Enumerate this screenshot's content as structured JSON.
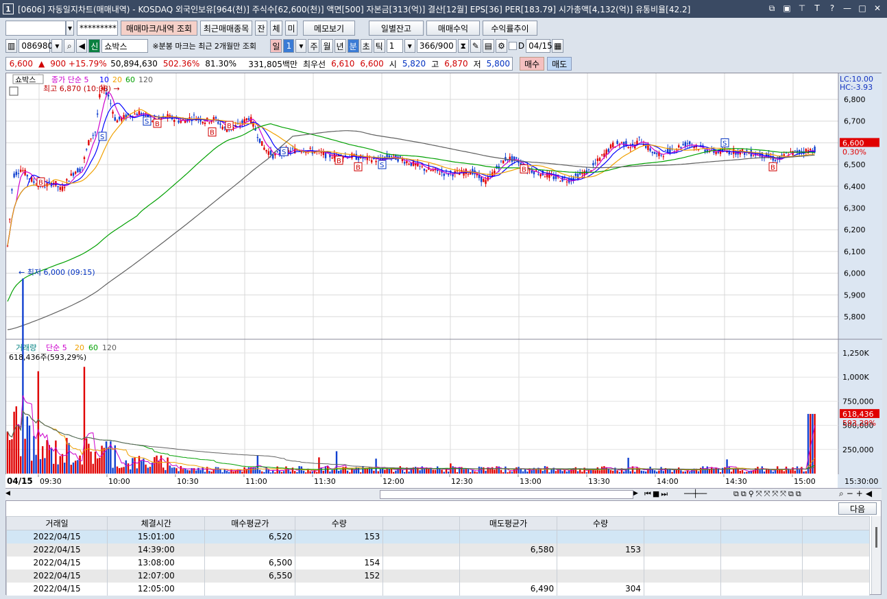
{
  "window": {
    "number": "1",
    "title": "[0606] 자동일지차트(매매내역) - KOSDAQ 외국인보유[964(천)] 주식수[62,600(천)] 액면[500] 자본금[313(억)] 결산[12월] EPS[36] PER[183.79] 시가총액[4,132(억)] 유통비율[42.2]",
    "ctrl_icons": [
      "restore-down-icon",
      "tile-icon",
      "pin-icon",
      "font-icon",
      "help-icon",
      "minimize-icon",
      "maximize-icon",
      "close-icon"
    ],
    "ctrl_glyphs": [
      "⧉",
      "▣",
      "⊤",
      "T",
      "?",
      "—",
      "□",
      "✕"
    ]
  },
  "toolbar1": {
    "account_value": "",
    "password_value": "*********",
    "buttons": [
      "매매마크/내역 조회",
      "최근매매종목",
      "잔",
      "체",
      "미",
      "메모보기",
      "일별잔고",
      "매매수익",
      "수익률추이"
    ]
  },
  "toolbar2": {
    "code": "086980",
    "stock_name": "쇼박스",
    "note": "※분봉 마크는 최근 2개월만 조회",
    "periods": [
      "일",
      "1",
      "주",
      "월",
      "년",
      "분",
      "초",
      "틱"
    ],
    "interval": "1",
    "count": "366/900",
    "d_label": "D",
    "date": "04/15"
  },
  "quote": {
    "price": "6,600",
    "arrow": "▲",
    "change": "900 +15.79%",
    "volume": "50,894,630",
    "vol_ratio": "502.36%",
    "rate": "81.30%",
    "amount": "331,805백만",
    "best_label": "최우선",
    "ask": "6,610",
    "bid": "6,600",
    "open_label": "시",
    "open": "5,820",
    "high_label": "고",
    "high": "6,870",
    "low_label": "저",
    "low": "5,800",
    "buy_btn": "매수",
    "sell_btn": "매도"
  },
  "price_panel": {
    "title": "쇼박스",
    "ma_label": "종가 단순 5",
    "ma": [
      "10",
      "20",
      "60",
      "120"
    ],
    "high_note": "최고 6,870 (10:08)",
    "low_note": "최저 6,000 (09:15)",
    "lc": "LC:10.00",
    "hc": "HC:-3.93",
    "y_ticks": [
      "6,800",
      "6,700",
      "6,600",
      "6,500",
      "6,400",
      "6,300",
      "6,200",
      "6,100",
      "6,000",
      "5,900",
      "5,800"
    ],
    "current": "6,600",
    "current_pct": "0.30%"
  },
  "volume_panel": {
    "title": "거래량",
    "ma_label": "단순 5",
    "ma": [
      "20",
      "60",
      "120"
    ],
    "note": "618,436주(593,29%)",
    "y_ticks": [
      "1,250K",
      "1,000K",
      "750,000",
      "500,000",
      "250,000"
    ],
    "current": "618,436",
    "current_pct": "593,29%"
  },
  "x_axis": {
    "date": "04/15",
    "ticks": [
      "09:30",
      "10:00",
      "10:30",
      "11:00",
      "11:30",
      "12:00",
      "12:30",
      "13:00",
      "13:30",
      "14:00",
      "14:30",
      "15:00"
    ],
    "end": "15:30:00"
  },
  "table": {
    "next_btn": "다음",
    "headers": [
      "거래일",
      "체결시간",
      "매수평균가",
      "수량",
      "",
      "매도평균가",
      "수량",
      "",
      "",
      ""
    ],
    "rows": [
      [
        "2022/04/15",
        "15:01:00",
        "6,520",
        "153",
        "",
        "",
        "",
        "",
        "",
        ""
      ],
      [
        "2022/04/15",
        "14:39:00",
        "",
        "",
        "",
        "6,580",
        "153",
        "",
        "",
        ""
      ],
      [
        "2022/04/15",
        "13:08:00",
        "6,500",
        "154",
        "",
        "",
        "",
        "",
        "",
        ""
      ],
      [
        "2022/04/15",
        "12:07:00",
        "6,550",
        "152",
        "",
        "",
        "",
        "",
        "",
        ""
      ],
      [
        "2022/04/15",
        "12:05:00",
        "",
        "",
        "",
        "6,490",
        "304",
        "",
        "",
        ""
      ]
    ]
  },
  "colors": {
    "up": "#e00000",
    "down": "#1040d0",
    "ma5": "#cc00cc",
    "ma10": "#0000ff",
    "ma20": "#f0a000",
    "ma60": "#00a000",
    "ma120": "#606060"
  }
}
